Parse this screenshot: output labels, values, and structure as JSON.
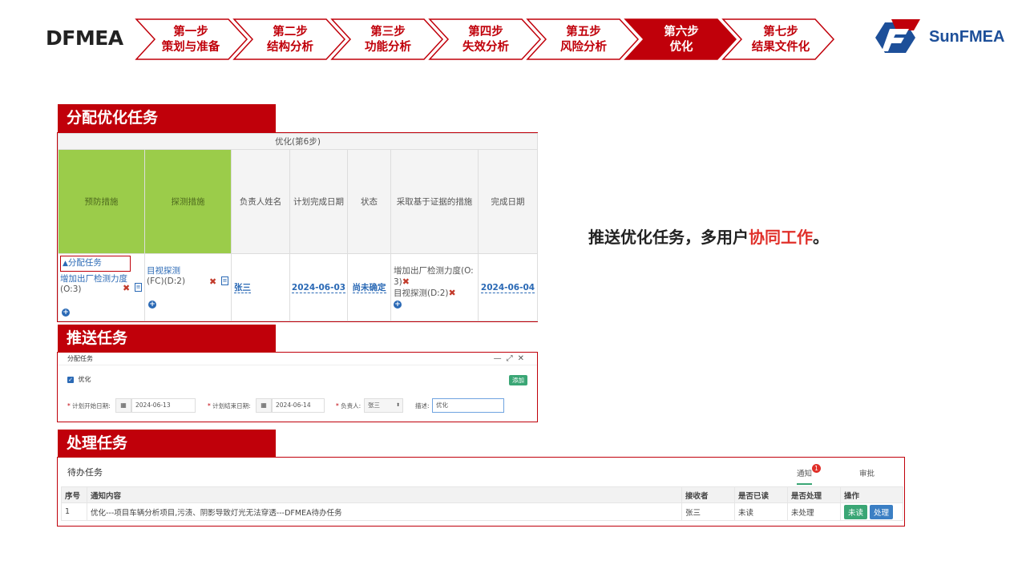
{
  "brand": {
    "title": "DFMEA",
    "logo_text": "SunFMEA"
  },
  "steps": [
    {
      "line1": "第一步",
      "line2": "策划与准备",
      "active": false
    },
    {
      "line1": "第二步",
      "line2": "结构分析",
      "active": false
    },
    {
      "line1": "第三步",
      "line2": "功能分析",
      "active": false
    },
    {
      "line1": "第四步",
      "line2": "失效分析",
      "active": false
    },
    {
      "line1": "第五步",
      "line2": "风险分析",
      "active": false
    },
    {
      "line1": "第六步",
      "line2": "优化",
      "active": true
    },
    {
      "line1": "第七步",
      "line2": "结果文件化",
      "active": false
    }
  ],
  "colors": {
    "accent": "#c0000a",
    "green_header": "#9bcc4a",
    "link": "#2a69b5",
    "brand_blue": "#1d4f99"
  },
  "section1": {
    "header": "分配优化任务",
    "group_title": "优化(第6步)",
    "columns": [
      "预防措施",
      "探测措施",
      "负责人姓名",
      "计划完成日期",
      "状态",
      "采取基于证据的措施",
      "完成日期"
    ],
    "row": {
      "assign_link": "分配任务",
      "prevention_action": "增加出厂检测力度",
      "prevention_rating": "(O:3)",
      "detection_action": "目视探测",
      "detection_rating": "(FC)(D:2)",
      "owner": "张三",
      "plan_date": "2024-06-03",
      "status": "尚未确定",
      "evidence_1a": "增加出厂检测力度(O:",
      "evidence_1b": "3)",
      "evidence_2": "目视探测(D:2)",
      "done_date": "2024-06-04"
    }
  },
  "section2": {
    "header": "推送任务",
    "dialog_title": "分配任务",
    "checkbox_label": "优化",
    "add_label": "添加",
    "start_label": "计划开始日期:",
    "start_value": "2024-06-13",
    "end_label": "计划结束日期:",
    "end_value": "2024-06-14",
    "owner_label": "负责人:",
    "owner_value": "张三",
    "desc_label": "描述:",
    "desc_value": "优化"
  },
  "section3": {
    "header": "处理任务",
    "panel_title": "待办任务",
    "tab_notify": "通知",
    "tab_notify_badge": "1",
    "tab_approve": "审批",
    "columns": [
      "序号",
      "通知内容",
      "接收者",
      "是否已读",
      "是否处理",
      "操作"
    ],
    "row": {
      "index": "1",
      "content": "优化---项目车辆分析项目,污渍、阴影导致灯光无法穿透---DFMEA待办任务",
      "receiver": "张三",
      "read": "未读",
      "handled": "未处理",
      "btn_unread": "未读",
      "btn_handle": "处理"
    }
  },
  "callout": {
    "text_before": "推送优化任务，多用户",
    "highlight": "协同工作",
    "text_after": "。"
  }
}
